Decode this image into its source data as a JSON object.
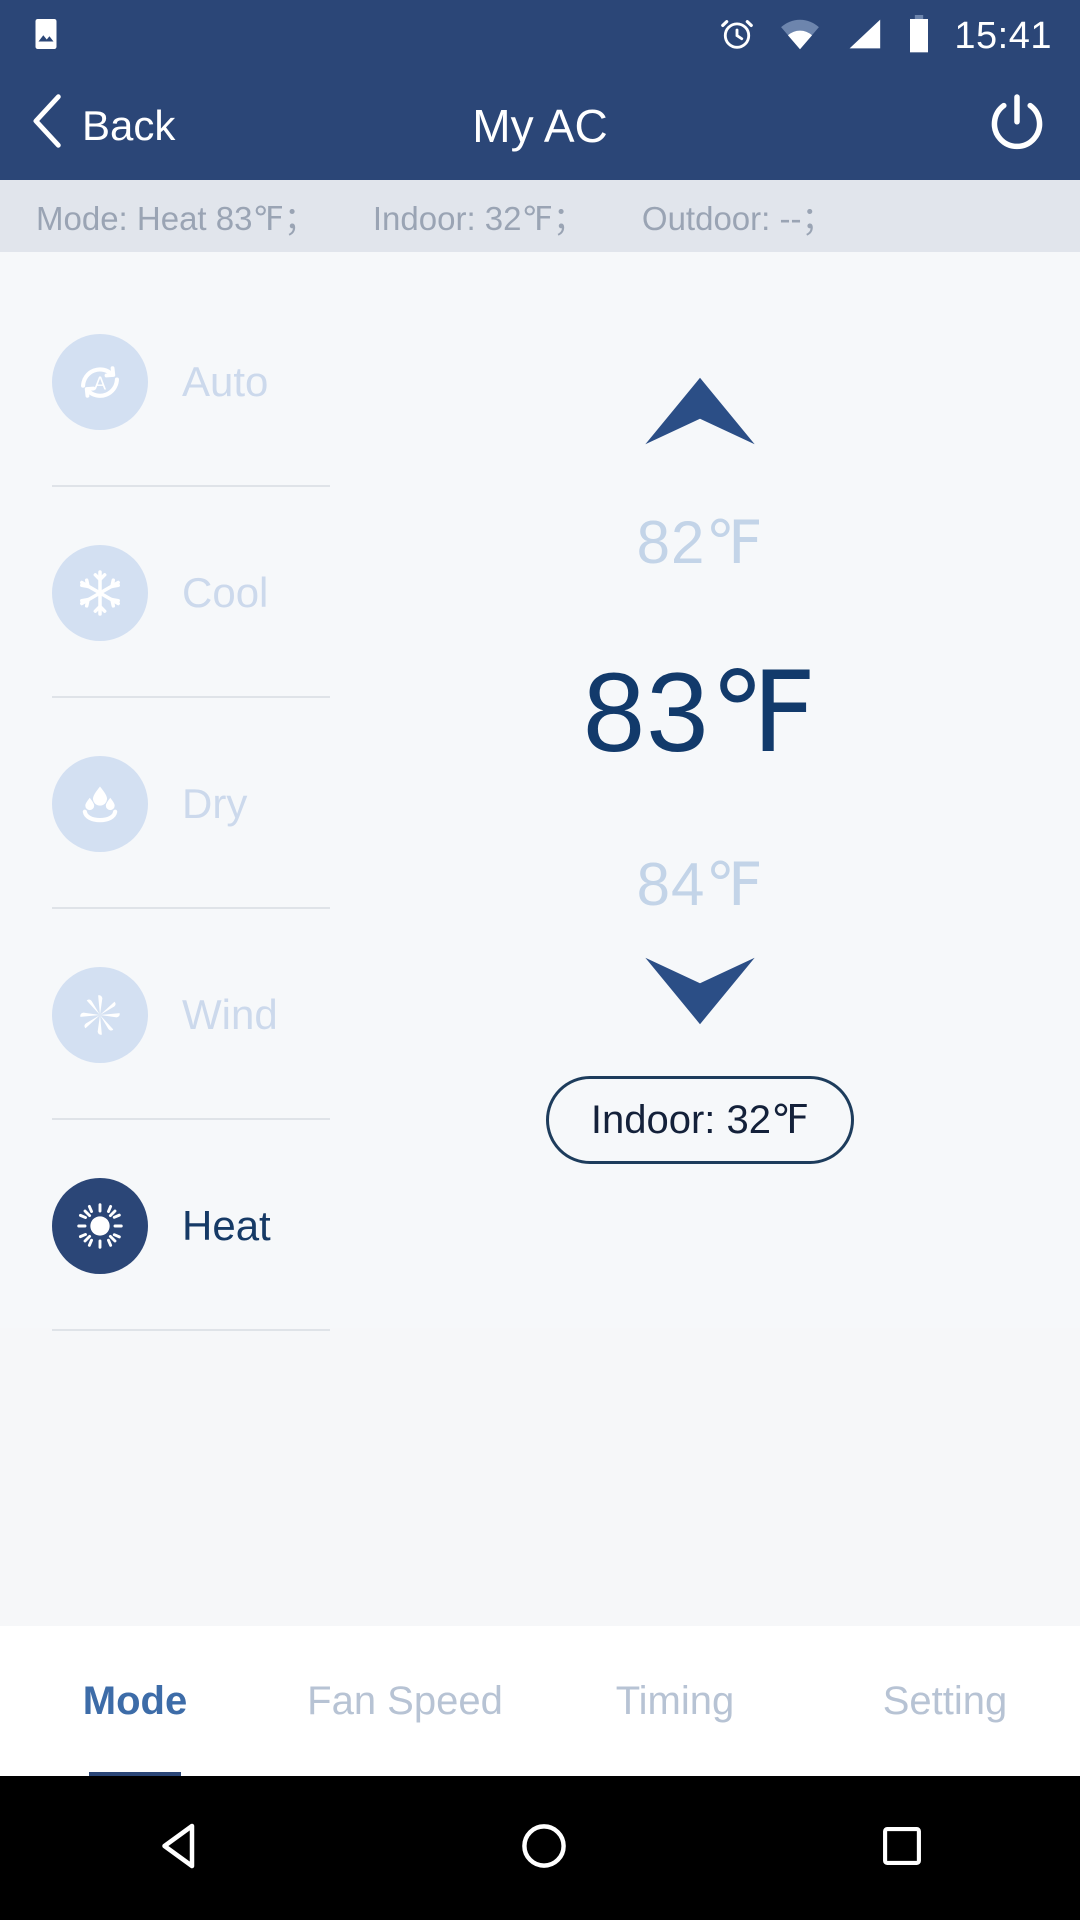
{
  "statusbar": {
    "time": "15:41",
    "icons": [
      "photo-icon",
      "alarm-icon",
      "wifi-icon",
      "signal-icon",
      "battery-icon"
    ]
  },
  "appbar": {
    "back_label": "Back",
    "title": "My AC",
    "power_icon": "power-icon"
  },
  "infobar": {
    "mode": "Mode: Heat 83℉；",
    "indoor": "Indoor: 32℉；",
    "outdoor": "Outdoor: --；"
  },
  "modes": [
    {
      "label": "Auto",
      "icon": "auto-icon",
      "selected": false
    },
    {
      "label": "Cool",
      "icon": "snowflake-icon",
      "selected": false
    },
    {
      "label": "Dry",
      "icon": "droplet-icon",
      "selected": false
    },
    {
      "label": "Wind",
      "icon": "fan-icon",
      "selected": false
    },
    {
      "label": "Heat",
      "icon": "sun-icon",
      "selected": true
    }
  ],
  "temperature": {
    "up_icon": "chevron-up-icon",
    "down_icon": "chevron-down-icon",
    "above": "82℉",
    "current": "83℉",
    "below": "84℉",
    "indoor_pill": "Indoor: 32℉"
  },
  "tabs": [
    {
      "label": "Mode",
      "active": true
    },
    {
      "label": "Fan Speed",
      "active": false
    },
    {
      "label": "Timing",
      "active": false
    },
    {
      "label": "Setting",
      "active": false
    }
  ],
  "navbar": {
    "back_icon": "nav-back-triangle-icon",
    "home_icon": "nav-home-circle-icon",
    "recents_icon": "nav-recents-square-icon"
  },
  "colors": {
    "brand": "#2b4677",
    "accent": "#123a6b",
    "muted": "#c3d4e8",
    "infobar_bg": "#e1e5ec"
  }
}
